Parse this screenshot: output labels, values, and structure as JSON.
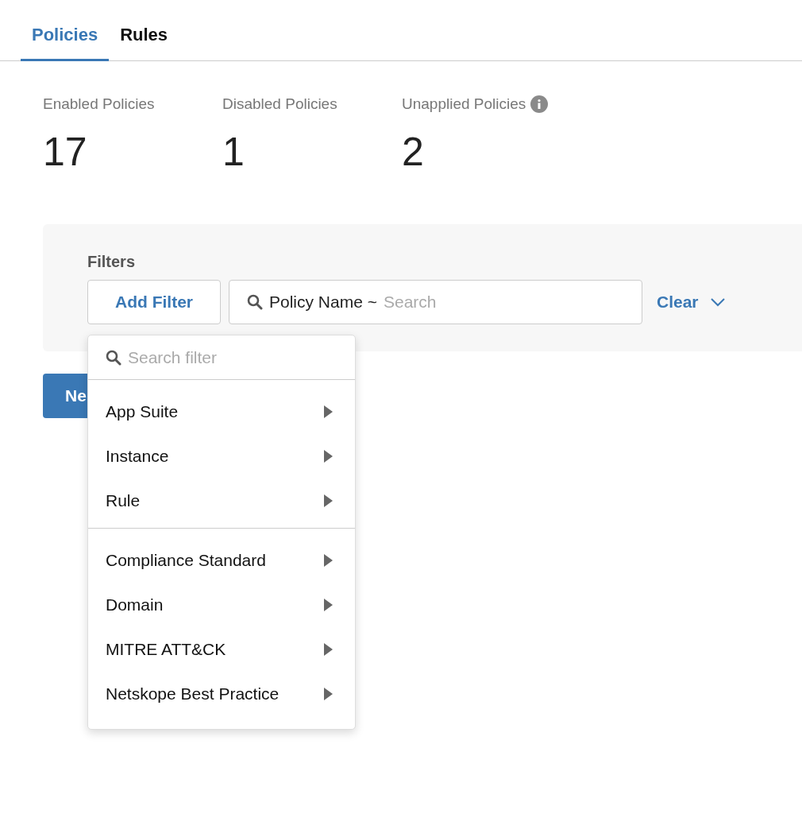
{
  "tabs": [
    {
      "label": "Policies",
      "selected": true
    },
    {
      "label": "Rules",
      "selected": false
    }
  ],
  "stats": [
    {
      "label": "Enabled Policies",
      "value": "17",
      "info": false
    },
    {
      "label": "Disabled Policies",
      "value": "1",
      "info": false
    },
    {
      "label": "Unapplied Policies",
      "value": "2",
      "info": true
    }
  ],
  "filters": {
    "title": "Filters",
    "add_button": "Add Filter",
    "search": {
      "field": "Policy Name ~",
      "placeholder": "Search"
    },
    "clear": "Clear"
  },
  "new_button": "Ne",
  "menu": {
    "placeholder": "Search filter",
    "groups": [
      [
        {
          "label": "App Suite"
        },
        {
          "label": "Instance"
        },
        {
          "label": "Rule"
        }
      ],
      [
        {
          "label": "Compliance Standard"
        },
        {
          "label": "Domain"
        },
        {
          "label": "MITRE ATT&CK"
        },
        {
          "label": "Netskope Best Practice"
        }
      ]
    ]
  }
}
